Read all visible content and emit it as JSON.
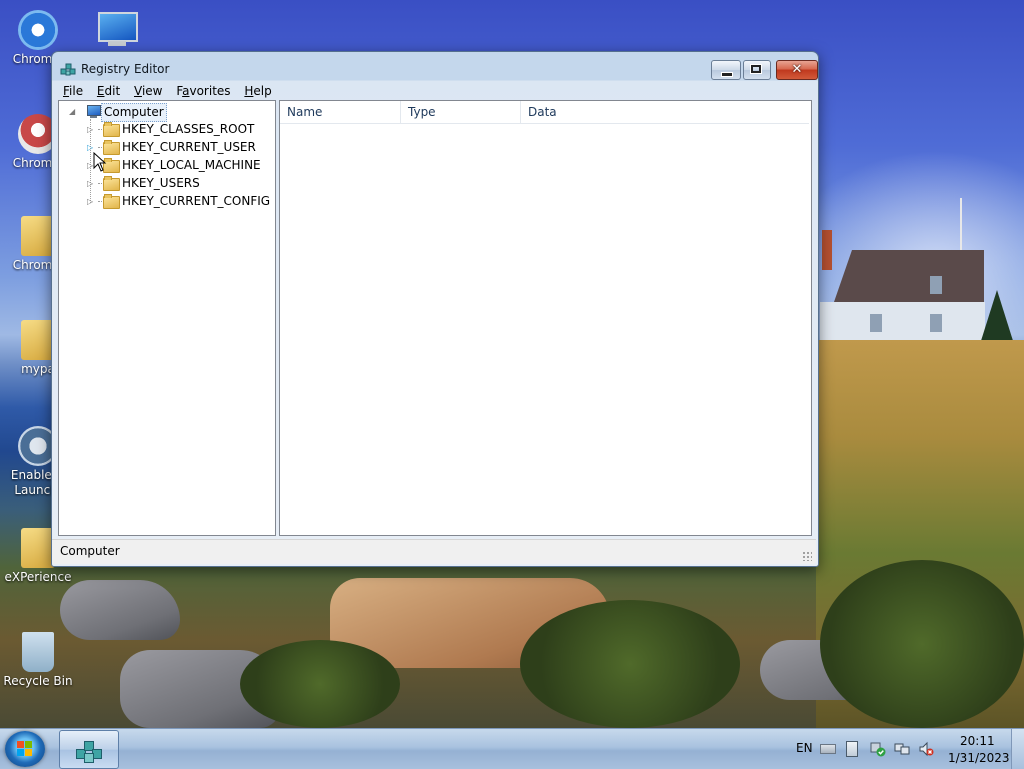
{
  "desktop": {
    "icons": [
      {
        "label": "Chromiu",
        "icon": "chromium-shortcut-icon"
      },
      {
        "label": "Chromiu",
        "icon": "chromium-icon"
      },
      {
        "label": "Chromiu",
        "icon": "folder-chromium-icon"
      },
      {
        "label": "mypa",
        "icon": "folder-icon"
      },
      {
        "label": "Enable Q Launch.",
        "icon": "launch-icon"
      },
      {
        "label": "eXPerience",
        "icon": "folder-icon"
      },
      {
        "label": "Recycle Bin",
        "icon": "recycle-bin-icon"
      }
    ]
  },
  "window": {
    "title": "Registry Editor",
    "menu": [
      {
        "label": "File",
        "accel": "F"
      },
      {
        "label": "Edit",
        "accel": "E"
      },
      {
        "label": "View",
        "accel": "V"
      },
      {
        "label": "Favorites",
        "accel": "a"
      },
      {
        "label": "Help",
        "accel": "H"
      }
    ],
    "tree": {
      "root": "Computer",
      "keys": [
        "HKEY_CLASSES_ROOT",
        "HKEY_CURRENT_USER",
        "HKEY_LOCAL_MACHINE",
        "HKEY_USERS",
        "HKEY_CURRENT_CONFIG"
      ]
    },
    "list_columns": [
      "Name",
      "Type",
      "Data"
    ],
    "status": "Computer"
  },
  "taskbar": {
    "language": "EN",
    "time": "20:11",
    "date": "1/31/2023"
  },
  "colors": {
    "titlebar": "#c4d7ec",
    "close_button": "#c0381e",
    "taskbar": "#a9c2df",
    "header_text": "#1e395b"
  }
}
